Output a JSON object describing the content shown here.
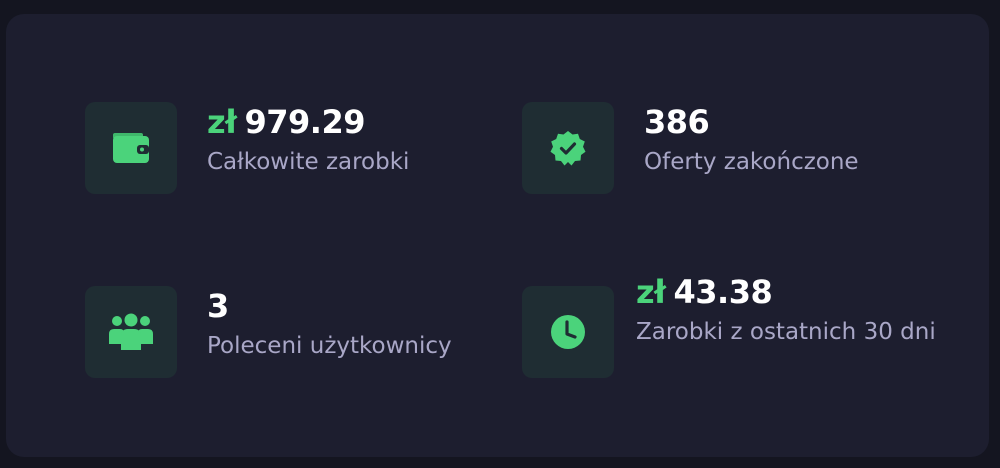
{
  "stats": {
    "total_earnings": {
      "currency": "zł",
      "value": "979.29",
      "label": "Całkowite zarobki",
      "icon": "wallet-icon"
    },
    "offers_completed": {
      "value": "386",
      "label": "Oferty zakończone",
      "icon": "verified-badge-icon"
    },
    "referred_users": {
      "value": "3",
      "label": "Poleceni użytkownicy",
      "icon": "users-group-icon"
    },
    "recent_earnings": {
      "currency": "zł",
      "value": "43.38",
      "label": "Zarobki z ostatnich 30 dni",
      "icon": "clock-icon"
    }
  },
  "colors": {
    "accent": "#4bd37b",
    "card_bg": "#1d1e2f",
    "icon_bg": "#1f2d33",
    "label": "#a9a7c7"
  }
}
